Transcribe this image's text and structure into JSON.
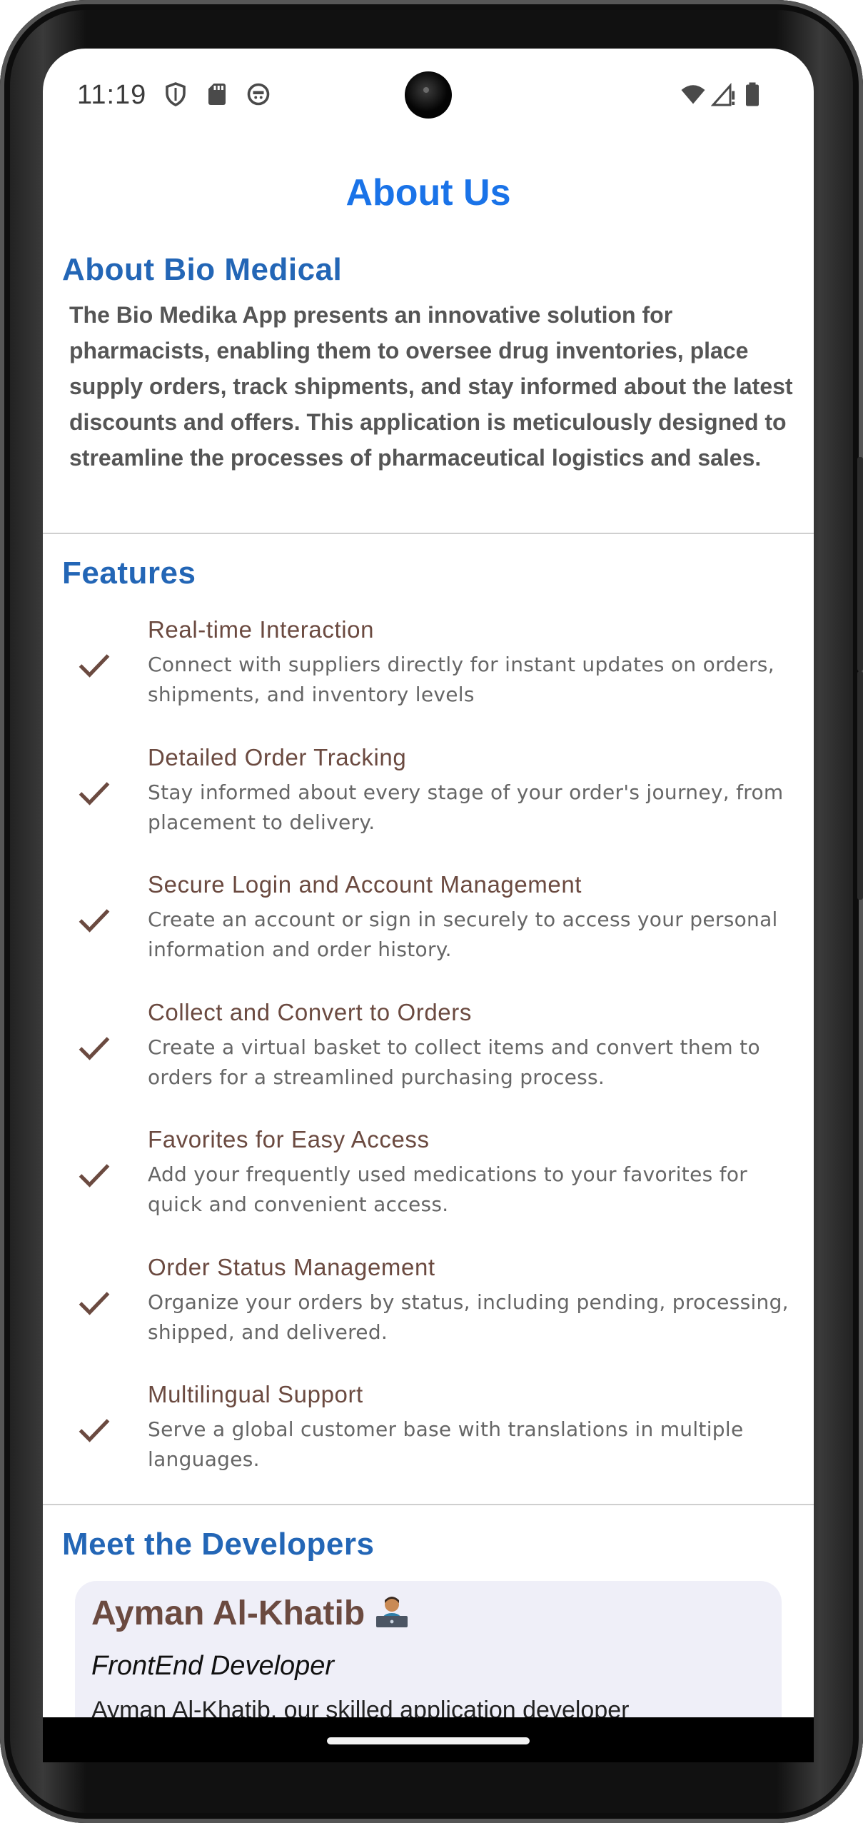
{
  "status_bar": {
    "time": "11:19",
    "left_icons": [
      "shield-icon",
      "sd-card-icon",
      "app-notification-icon"
    ],
    "right_icons": [
      "wifi-icon",
      "signal-alert-icon",
      "battery-icon"
    ]
  },
  "page": {
    "title": "About Us"
  },
  "about": {
    "heading": "About Bio Medical",
    "text": "The Bio Medika App presents an innovative solution for pharmacists, enabling them to oversee drug inventories, place supply orders, track shipments, and stay informed about the latest discounts and offers. This application is meticulously designed to streamline the processes of pharmaceutical logistics and sales."
  },
  "features": {
    "heading": "Features",
    "items": [
      {
        "title": "Real-time Interaction",
        "desc": "Connect with suppliers directly for instant updates on orders, shipments, and inventory levels"
      },
      {
        "title": "Detailed Order Tracking",
        "desc": "Stay informed about every stage of your order's journey, from placement to delivery."
      },
      {
        "title": "Secure Login and Account Management",
        "desc": "Create an account or sign in securely to access your personal information and order history."
      },
      {
        "title": "Collect and Convert to Orders",
        "desc": "Create a virtual basket to collect items and convert them to orders for a streamlined purchasing process."
      },
      {
        "title": "Favorites for Easy Access",
        "desc": "Add your frequently used medications to your favorites for quick and convenient access."
      },
      {
        "title": "Order Status Management",
        "desc": "Organize your orders by status, including pending, processing, shipped, and delivered."
      },
      {
        "title": "Multilingual Support",
        "desc": "Serve a global customer base with translations in multiple languages."
      }
    ]
  },
  "developers": {
    "heading": "Meet the Developers",
    "cards": [
      {
        "name": "Ayman Al-Khatib",
        "emoji": "technologist-emoji",
        "role": "FrontEnd Developer",
        "text": "Ayman Al-Khatib, our skilled application developer"
      }
    ]
  },
  "colors": {
    "title_blue": "#1a73e8",
    "heading_blue": "#2366b6",
    "feature_brown": "#6b4a40",
    "card_bg": "#efeff8"
  }
}
